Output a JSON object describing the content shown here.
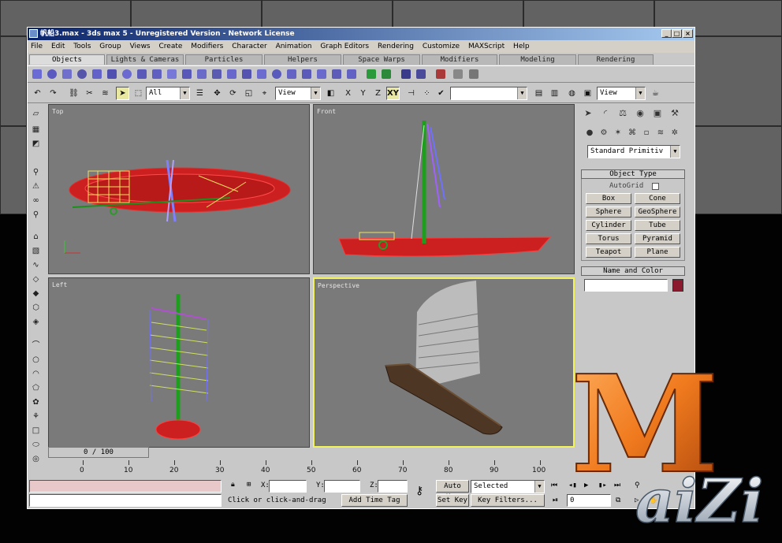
{
  "window": {
    "title": "帆船3.max - 3ds max 5 - Unregistered Version - Network License"
  },
  "menu": [
    "File",
    "Edit",
    "Tools",
    "Group",
    "Views",
    "Create",
    "Modifiers",
    "Character",
    "Animation",
    "Graph Editors",
    "Rendering",
    "Customize",
    "MAXScript",
    "Help"
  ],
  "tabs": [
    "Objects",
    "Lights & Cameras",
    "Particles",
    "Helpers",
    "Space Warps",
    "Modifiers",
    "Modeling",
    "Rendering"
  ],
  "toolbar": {
    "selection_filter": "All",
    "ref_coord": "View",
    "axis_x": "X",
    "axis_y": "Y",
    "axis_z": "Z",
    "axis_xy": "XY",
    "named_sets": "",
    "render_view": "View"
  },
  "viewports": {
    "top": "Top",
    "front": "Front",
    "left": "Left",
    "perspective": "Perspective"
  },
  "command_panel": {
    "dropdown": "Standard Primitiv",
    "object_type_header": "Object Type",
    "autogrid": "AutoGrid",
    "buttons": [
      "Box",
      "Cone",
      "Sphere",
      "GeoSphere",
      "Cylinder",
      "Tube",
      "Torus",
      "Pyramid",
      "Teapot",
      "Plane"
    ],
    "name_color_header": "Name and Color",
    "name_value": "",
    "color": "#8b1a2e"
  },
  "timeline": {
    "slider": "0 / 100",
    "ticks": [
      "0",
      "10",
      "20",
      "30",
      "40",
      "50",
      "60",
      "70",
      "80",
      "90",
      "100"
    ]
  },
  "status": {
    "prompt": "Click or click-and-drag",
    "time_tag": "Add Time Tag",
    "x_label": "X:",
    "y_label": "Y:",
    "z_label": "Z:",
    "auto_key": "Auto Key",
    "set_key": "Set Key",
    "selected": "Selected",
    "key_filters": "Key Filters...",
    "frame": "0"
  },
  "logo": {
    "big_letter": "M",
    "text": "aiZi"
  },
  "colors": {
    "hull": "#cc1f1f",
    "viewport_bg": "#7a7a7a",
    "active_border": "#f2f25a",
    "logo_orange": "#f07a1e"
  }
}
